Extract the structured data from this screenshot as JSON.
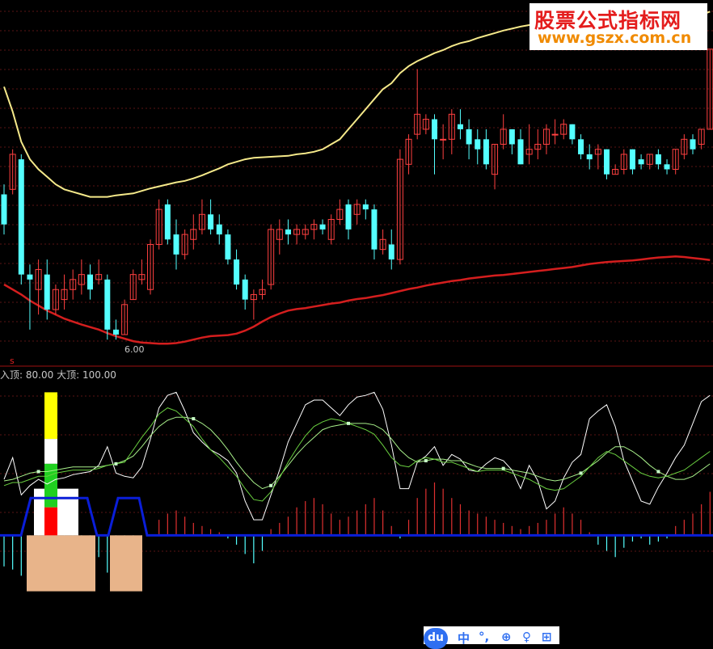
{
  "watermark": {
    "line1": "股票公式指标网",
    "line2": "www.gszx.com.cn"
  },
  "price_panel": {
    "low_marker": "6.00",
    "signal_marker": "s"
  },
  "indicator_legend": {
    "small_top_label": "入顶:",
    "small_top_value": "80.00",
    "big_top_label": "大顶:",
    "big_top_value": "100.00"
  },
  "toolbar": {
    "logo": "du",
    "mid": "中",
    "dots": "°,",
    "i1": "⊕",
    "i2": "♀",
    "i3": "⊞"
  },
  "colors": {
    "up": "#ff4040",
    "down": "#54ffff",
    "upper_band": "#f5e98a",
    "lower_band": "#d41e1e",
    "baseline": "#0a1ed8",
    "k_line": "#ffffff",
    "d_line": "#a8f08a",
    "j_line": "#6ad040"
  },
  "chart_data": [
    {
      "type": "candlestick",
      "candles": [
        [
          8.9,
          9.1,
          8.1,
          8.3
        ],
        [
          9.0,
          9.8,
          8.9,
          9.7
        ],
        [
          9.6,
          9.7,
          7.1,
          7.3
        ],
        [
          7.3,
          7.5,
          6.2,
          7.2
        ],
        [
          7.0,
          7.6,
          6.5,
          7.4
        ],
        [
          7.3,
          7.6,
          6.4,
          6.6
        ],
        [
          6.6,
          7.1,
          6.5,
          7.0
        ],
        [
          6.8,
          7.3,
          6.6,
          7.0
        ],
        [
          7.0,
          7.4,
          6.8,
          7.2
        ],
        [
          7.1,
          7.6,
          6.9,
          7.3
        ],
        [
          7.3,
          7.5,
          6.8,
          7.0
        ],
        [
          7.2,
          7.6,
          7.1,
          7.3
        ],
        [
          7.2,
          7.3,
          6.0,
          6.2
        ],
        [
          6.2,
          6.4,
          6.0,
          6.1
        ],
        [
          6.1,
          6.8,
          6.1,
          6.7
        ],
        [
          6.8,
          7.4,
          6.8,
          7.3
        ],
        [
          7.2,
          7.6,
          7.1,
          7.3
        ],
        [
          7.0,
          8.0,
          6.9,
          7.9
        ],
        [
          7.9,
          8.8,
          7.8,
          8.6
        ],
        [
          8.7,
          8.8,
          7.9,
          8.0
        ],
        [
          8.1,
          8.4,
          7.4,
          7.7
        ],
        [
          7.7,
          8.2,
          7.6,
          8.1
        ],
        [
          8.0,
          8.5,
          7.8,
          8.2
        ],
        [
          8.2,
          8.8,
          8.1,
          8.5
        ],
        [
          8.5,
          8.8,
          8.1,
          8.2
        ],
        [
          8.3,
          8.5,
          7.9,
          8.1
        ],
        [
          8.1,
          8.2,
          7.5,
          7.6
        ],
        [
          7.6,
          7.8,
          7.0,
          7.1
        ],
        [
          7.2,
          7.3,
          6.6,
          6.8
        ],
        [
          6.8,
          7.0,
          6.4,
          6.9
        ],
        [
          6.9,
          7.2,
          6.8,
          7.0
        ],
        [
          7.1,
          8.3,
          7.0,
          8.2
        ],
        [
          8.0,
          8.4,
          7.7,
          8.2
        ],
        [
          8.2,
          8.4,
          7.9,
          8.1
        ],
        [
          8.1,
          8.3,
          7.9,
          8.2
        ],
        [
          8.1,
          8.3,
          8.0,
          8.2
        ],
        [
          8.2,
          8.4,
          8.0,
          8.3
        ],
        [
          8.3,
          8.4,
          8.1,
          8.2
        ],
        [
          8.0,
          8.5,
          7.9,
          8.4
        ],
        [
          8.4,
          8.8,
          8.3,
          8.6
        ],
        [
          8.7,
          8.8,
          8.0,
          8.2
        ],
        [
          8.5,
          8.8,
          8.3,
          8.7
        ],
        [
          8.7,
          8.8,
          8.4,
          8.6
        ],
        [
          8.6,
          8.7,
          7.6,
          7.8
        ],
        [
          7.8,
          8.2,
          7.7,
          8.0
        ],
        [
          7.9,
          8.2,
          7.4,
          7.6
        ],
        [
          7.6,
          9.8,
          7.5,
          9.6
        ],
        [
          9.5,
          10.1,
          9.3,
          10.0
        ],
        [
          10.1,
          11.4,
          10.0,
          10.5
        ],
        [
          10.2,
          10.5,
          10.1,
          10.4
        ],
        [
          10.4,
          10.5,
          9.3,
          10.0
        ],
        [
          10.0,
          10.3,
          9.6,
          10.0
        ],
        [
          10.0,
          10.6,
          9.7,
          10.5
        ],
        [
          10.3,
          10.6,
          10.0,
          10.2
        ],
        [
          10.2,
          10.4,
          9.6,
          9.9
        ],
        [
          10.0,
          10.2,
          9.5,
          9.8
        ],
        [
          10.0,
          10.2,
          9.4,
          9.5
        ],
        [
          9.3,
          9.9,
          9.0,
          9.9
        ],
        [
          9.9,
          10.5,
          9.8,
          10.2
        ],
        [
          10.2,
          10.2,
          9.7,
          9.9
        ],
        [
          10.0,
          10.2,
          9.5,
          9.5
        ],
        [
          9.7,
          10.3,
          9.5,
          9.8
        ],
        [
          9.8,
          10.2,
          9.6,
          9.9
        ],
        [
          9.9,
          10.3,
          9.7,
          10.2
        ],
        [
          10.1,
          10.4,
          9.9,
          10.1
        ],
        [
          10.1,
          10.4,
          10.0,
          10.3
        ],
        [
          10.3,
          10.3,
          9.9,
          10.0
        ],
        [
          10.0,
          10.1,
          9.6,
          9.7
        ],
        [
          9.7,
          9.9,
          9.4,
          9.6
        ],
        [
          9.7,
          9.9,
          9.4,
          9.8
        ],
        [
          9.8,
          9.8,
          9.2,
          9.3
        ],
        [
          9.3,
          9.5,
          9.3,
          9.4
        ],
        [
          9.4,
          9.8,
          9.3,
          9.7
        ],
        [
          9.8,
          9.8,
          9.3,
          9.4
        ],
        [
          9.6,
          9.7,
          9.4,
          9.5
        ],
        [
          9.5,
          9.7,
          9.4,
          9.7
        ],
        [
          9.7,
          9.8,
          9.4,
          9.5
        ],
        [
          9.5,
          9.6,
          9.3,
          9.4
        ],
        [
          9.4,
          9.8,
          9.3,
          9.8
        ],
        [
          9.7,
          10.1,
          9.6,
          10.0
        ],
        [
          10.0,
          10.1,
          9.7,
          9.8
        ],
        [
          9.9,
          10.2,
          9.8,
          10.2
        ],
        [
          10.2,
          11.8,
          10.2,
          11.8
        ]
      ],
      "upper_band": [
        11.05,
        10.55,
        9.95,
        9.6,
        9.4,
        9.25,
        9.1,
        9.0,
        8.95,
        8.9,
        8.85,
        8.85,
        8.85,
        8.88,
        8.9,
        8.92,
        8.97,
        9.02,
        9.06,
        9.1,
        9.14,
        9.17,
        9.22,
        9.28,
        9.35,
        9.42,
        9.5,
        9.55,
        9.6,
        9.63,
        9.64,
        9.65,
        9.66,
        9.67,
        9.7,
        9.72,
        9.75,
        9.8,
        9.9,
        10.0,
        10.2,
        10.4,
        10.6,
        10.8,
        11.0,
        11.12,
        11.32,
        11.46,
        11.56,
        11.64,
        11.72,
        11.78,
        11.86,
        11.92,
        11.96,
        12.02,
        12.07,
        12.12,
        12.17,
        12.21,
        12.25,
        12.28,
        12.28,
        12.24,
        12.2,
        12.17,
        12.14,
        12.12,
        12.11,
        12.11,
        12.11,
        12.11,
        12.11,
        12.11,
        12.12,
        12.13,
        12.15,
        12.19,
        12.24,
        12.31,
        12.4,
        12.48,
        12.55
      ],
      "lower_band": [
        7.1,
        7.0,
        6.9,
        6.78,
        6.68,
        6.58,
        6.5,
        6.42,
        6.36,
        6.3,
        6.25,
        6.2,
        6.13,
        6.07,
        6.02,
        5.97,
        5.94,
        5.93,
        5.92,
        5.92,
        5.93,
        5.96,
        6.0,
        6.04,
        6.07,
        6.08,
        6.09,
        6.12,
        6.18,
        6.26,
        6.36,
        6.45,
        6.52,
        6.58,
        6.61,
        6.63,
        6.66,
        6.69,
        6.72,
        6.74,
        6.78,
        6.81,
        6.83,
        6.86,
        6.89,
        6.93,
        6.97,
        7.01,
        7.04,
        7.08,
        7.11,
        7.14,
        7.17,
        7.19,
        7.22,
        7.24,
        7.26,
        7.28,
        7.29,
        7.31,
        7.33,
        7.35,
        7.37,
        7.39,
        7.41,
        7.43,
        7.45,
        7.48,
        7.51,
        7.53,
        7.55,
        7.56,
        7.57,
        7.58,
        7.6,
        7.62,
        7.64,
        7.65,
        7.66,
        7.65,
        7.63,
        7.61,
        7.59
      ],
      "ylim": [
        5.6,
        12.7
      ]
    },
    {
      "type": "line",
      "ylim": [
        -70,
        100
      ],
      "series": [
        {
          "key": "k",
          "values": [
            36,
            50,
            26,
            32,
            36,
            33,
            36,
            37,
            39,
            40,
            41,
            45,
            57,
            40,
            38,
            37,
            44,
            62,
            82,
            90,
            92,
            80,
            66,
            60,
            55,
            52,
            48,
            40,
            22,
            10,
            10,
            26,
            42,
            60,
            72,
            84,
            87,
            87,
            82,
            77,
            84,
            89,
            90,
            92,
            81,
            58,
            30,
            30,
            47,
            51,
            57,
            45,
            52,
            49,
            42,
            41,
            46,
            50,
            48,
            42,
            30,
            45,
            35,
            17,
            22,
            37,
            47,
            52,
            75,
            80,
            84,
            70,
            48,
            35,
            22,
            20,
            31,
            40,
            50,
            58,
            72,
            86,
            90
          ]
        },
        {
          "key": "d",
          "values": [
            35,
            36,
            38,
            40,
            41,
            41,
            42,
            43,
            44,
            44,
            44,
            44,
            45,
            46,
            48,
            51,
            57,
            64,
            70,
            74,
            76,
            76,
            75,
            72,
            68,
            62,
            55,
            47,
            40,
            34,
            30,
            32,
            38,
            45,
            52,
            58,
            63,
            68,
            70,
            71,
            72,
            72,
            72,
            71,
            68,
            62,
            55,
            50,
            47,
            48,
            49,
            49,
            48,
            48,
            46,
            44,
            43,
            43,
            43,
            42,
            41,
            40,
            38,
            36,
            35,
            36,
            38,
            40,
            44,
            48,
            53,
            57,
            57,
            54,
            50,
            45,
            41,
            38,
            36,
            36,
            38,
            42,
            46
          ]
        },
        {
          "key": "j",
          "values": [
            32,
            34,
            34,
            36,
            38,
            38,
            40,
            41,
            42,
            42,
            42,
            43,
            45,
            46,
            47,
            55,
            63,
            70,
            78,
            82,
            80,
            75,
            70,
            62,
            55,
            50,
            44,
            38,
            30,
            23,
            22,
            28,
            37,
            47,
            56,
            64,
            70,
            73,
            75,
            74,
            72,
            70,
            68,
            65,
            58,
            50,
            45,
            44,
            48,
            50,
            49,
            47,
            47,
            45,
            43,
            41,
            42,
            42,
            42,
            40,
            38,
            36,
            33,
            30,
            29,
            30,
            34,
            38,
            44,
            50,
            54,
            52,
            48,
            44,
            40,
            38,
            37,
            38,
            40,
            42,
            46,
            50,
            54
          ]
        }
      ],
      "histogram": [
        -20,
        -22,
        -26,
        -20,
        -14,
        -18,
        -10,
        -8,
        -6,
        -4,
        -12,
        -14,
        -24,
        -18,
        -10,
        -8,
        -4,
        0,
        10,
        14,
        16,
        12,
        8,
        6,
        4,
        2,
        -2,
        -6,
        -12,
        -18,
        -10,
        4,
        8,
        12,
        18,
        22,
        24,
        20,
        14,
        10,
        12,
        16,
        20,
        24,
        16,
        6,
        -2,
        10,
        24,
        30,
        34,
        30,
        24,
        20,
        16,
        14,
        12,
        10,
        8,
        6,
        4,
        6,
        8,
        10,
        14,
        18,
        14,
        10,
        2,
        -6,
        -10,
        -14,
        -8,
        -4,
        -2,
        -6,
        -4,
        -2,
        6,
        10,
        14,
        20,
        28
      ],
      "gauge_values": [
        -70,
        -70,
        -65,
        -55,
        -45,
        -38,
        -45,
        -55,
        -65,
        -70,
        -65,
        -50,
        -42,
        -42,
        -40,
        -40,
        -65,
        -70
      ]
    }
  ]
}
